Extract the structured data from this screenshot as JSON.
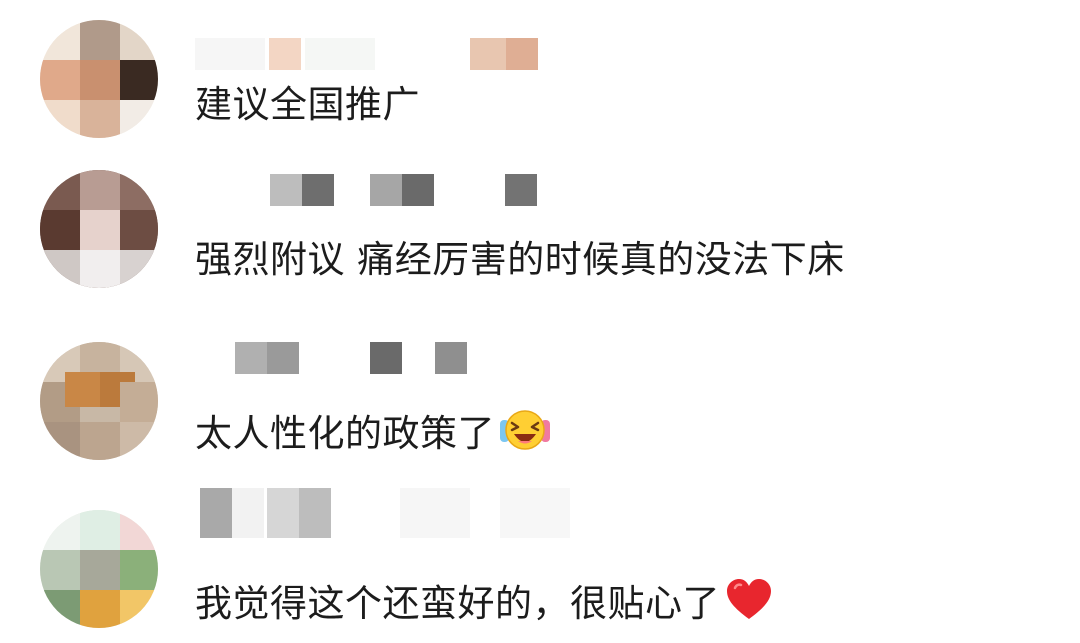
{
  "comments": [
    {
      "text": "建议全国推广",
      "emoji": ""
    },
    {
      "text": "强烈附议 痛经厉害的时候真的没法下床",
      "emoji": ""
    },
    {
      "text": "太人性化的政策了",
      "emoji": "laughing-tears-emoji"
    },
    {
      "text": "我觉得这个还蛮好的，很贴心了",
      "emoji": "red-heart-emoji"
    }
  ],
  "colors": {
    "text": "#1c1c1c",
    "background": "#ffffff",
    "heart": "#e8262e"
  }
}
